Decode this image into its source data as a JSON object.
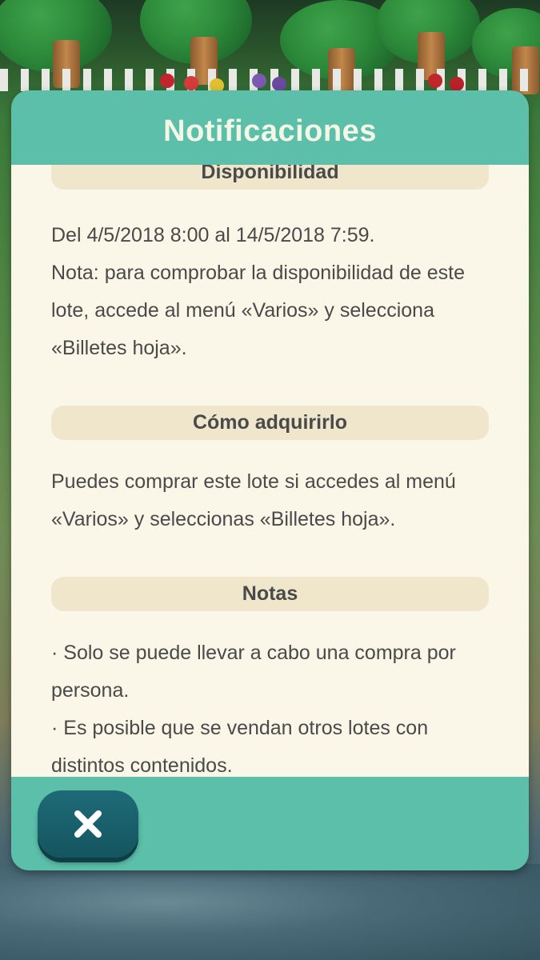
{
  "dialog": {
    "title": "Notificaciones",
    "close_icon": "close-icon"
  },
  "sections": [
    {
      "header": "Disponibilidad",
      "lines": [
        "Del 4/5/2018 8:00 al 14/5/2018 7:59.",
        "Nota: para comprobar la disponibilidad de este",
        "lote, accede al menú «Varios» y selecciona",
        "«Billetes hoja»."
      ]
    },
    {
      "header": "Cómo adquirirlo",
      "lines": [
        "Puedes comprar este lote si accedes al menú",
        "«Varios» y seleccionas «Billetes hoja»."
      ]
    },
    {
      "header": "Notas",
      "lines": [
        "· Solo se puede llevar a cabo una compra por",
        "persona.",
        "· Es posible que se vendan otros lotes con",
        "distintos contenidos."
      ]
    }
  ],
  "colors": {
    "dialog_frame": "#5bbfa9",
    "dialog_body": "#faf6e8",
    "section_header_bg": "#efe6cc",
    "text": "#4a4a4a",
    "close_button": "#14555f"
  }
}
